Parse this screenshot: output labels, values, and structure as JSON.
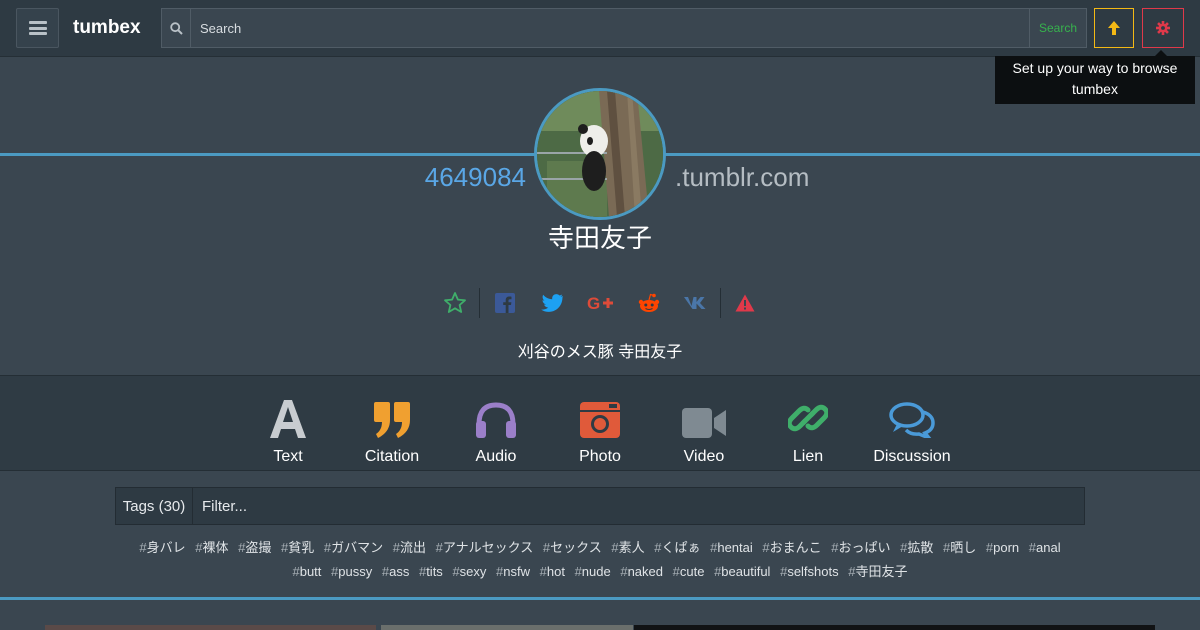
{
  "header": {
    "brand": "tumbex",
    "search_placeholder": "Search",
    "search_button": "Search",
    "tooltip": "Set up your way to browse tumbex"
  },
  "profile": {
    "blog_id": "4649084",
    "domain": ".tumblr.com",
    "name": "寺田友子",
    "description": "刈谷のメス豚 寺田友子"
  },
  "share_icons": [
    "star-icon",
    "facebook-icon",
    "twitter-icon",
    "google-plus-icon",
    "reddit-icon",
    "vk-icon",
    "warning-icon"
  ],
  "colors": {
    "accent": "#4b9ac2",
    "search_green": "#37b24d",
    "up_yellow": "#f4b915",
    "gear_red": "#e0394a",
    "text_type": "#c8ccd0",
    "citation": "#f0a030",
    "audio": "#9b7fc9",
    "photo": "#e05a3a",
    "video": "#7f8a92",
    "link": "#3fae6a",
    "chat": "#4a9ad8"
  },
  "post_types": [
    {
      "label": "Text",
      "icon": "text-icon"
    },
    {
      "label": "Citation",
      "icon": "quote-icon"
    },
    {
      "label": "Audio",
      "icon": "headphones-icon"
    },
    {
      "label": "Photo",
      "icon": "camera-icon"
    },
    {
      "label": "Video",
      "icon": "video-camera-icon"
    },
    {
      "label": "Lien",
      "icon": "link-icon"
    },
    {
      "label": "Discussion",
      "icon": "chat-icon"
    }
  ],
  "tags": {
    "count_label": "Tags (30)",
    "filter_placeholder": "Filter...",
    "items": [
      "身バレ",
      "裸体",
      "盗撮",
      "貧乳",
      "ガバマン",
      "流出",
      "アナルセックス",
      "セックス",
      "素人",
      "くぱぁ",
      "hentai",
      "おまんこ",
      "おっぱい",
      "拡散",
      "晒し",
      "porn",
      "anal",
      "butt",
      "pussy",
      "ass",
      "tits",
      "sexy",
      "nsfw",
      "hot",
      "nude",
      "naked",
      "cute",
      "beautiful",
      "selfshots",
      "寺田友子"
    ]
  }
}
